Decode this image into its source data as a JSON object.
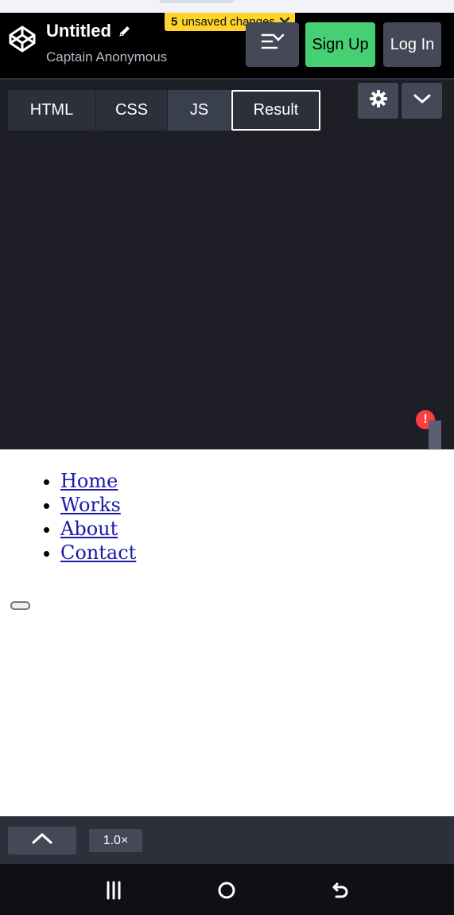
{
  "header": {
    "title": "Untitled",
    "subtitle": "Captain Anonymous",
    "unsaved_count": "5",
    "unsaved_text": "unsaved changes",
    "signup_label": "Sign Up",
    "login_label": "Log In",
    "icons": [
      "codepen-logo-icon",
      "pencil-icon",
      "close-icon",
      "layout-icon"
    ]
  },
  "editor": {
    "tabs": [
      {
        "label": "HTML"
      },
      {
        "label": "CSS"
      },
      {
        "label": "JS"
      },
      {
        "label": "Result",
        "active": true
      }
    ],
    "error_badge": "!",
    "icons": [
      "gear-icon",
      "chevron-down-icon"
    ]
  },
  "result": {
    "nav_links": [
      "Home",
      "Works",
      "About",
      "Contact"
    ]
  },
  "console_bar": {
    "zoom": "1.0×",
    "icons": [
      "chevron-up-icon"
    ]
  },
  "system_nav": {
    "icons": [
      "recent-apps-icon",
      "home-icon",
      "back-icon"
    ]
  },
  "colors": {
    "header_bg": "#000000",
    "editor_bg": "#1e1f26",
    "tab_bg": "#2c303a",
    "button_bg": "#444857",
    "signup_green": "#47cf73",
    "unsaved_yellow": "#ffd42a",
    "error_red": "#ff3c41"
  }
}
